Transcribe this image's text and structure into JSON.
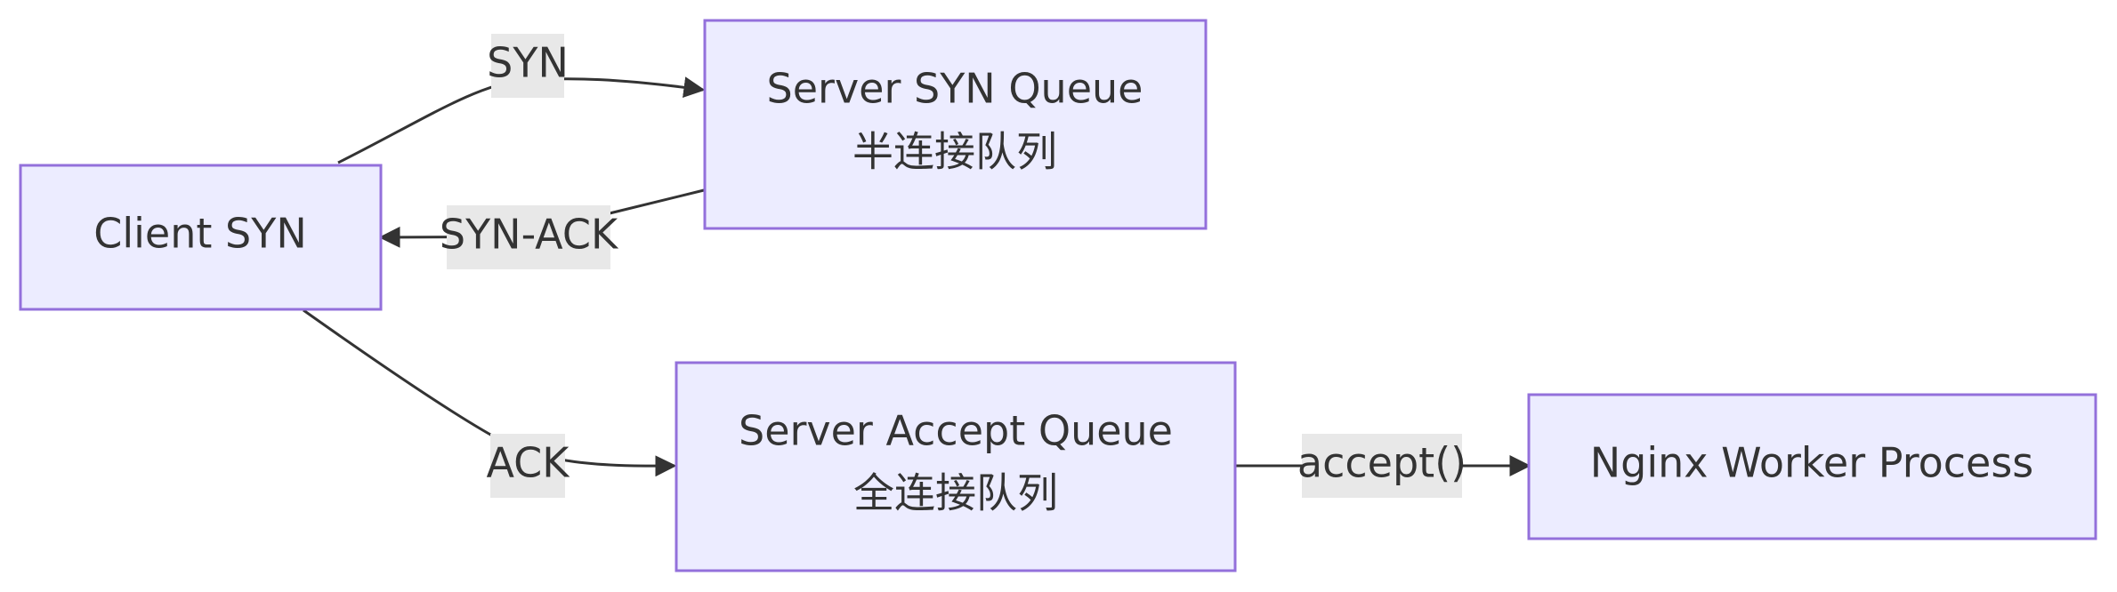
{
  "nodes": {
    "client": {
      "label": "Client SYN"
    },
    "syn_queue": {
      "line1": "Server SYN Queue",
      "line2": "半连接队列"
    },
    "accept_queue": {
      "line1": "Server Accept Queue",
      "line2": "全连接队列"
    },
    "nginx": {
      "label": "Nginx Worker Process"
    }
  },
  "edges": {
    "syn": "SYN",
    "syn_ack": "SYN-ACK",
    "ack": "ACK",
    "accept": "accept()"
  },
  "colors": {
    "node_fill": "#ECECFF",
    "node_stroke": "#9370DB",
    "edge": "#333333",
    "label_bg": "#E8E8E8",
    "text": "#333333"
  }
}
